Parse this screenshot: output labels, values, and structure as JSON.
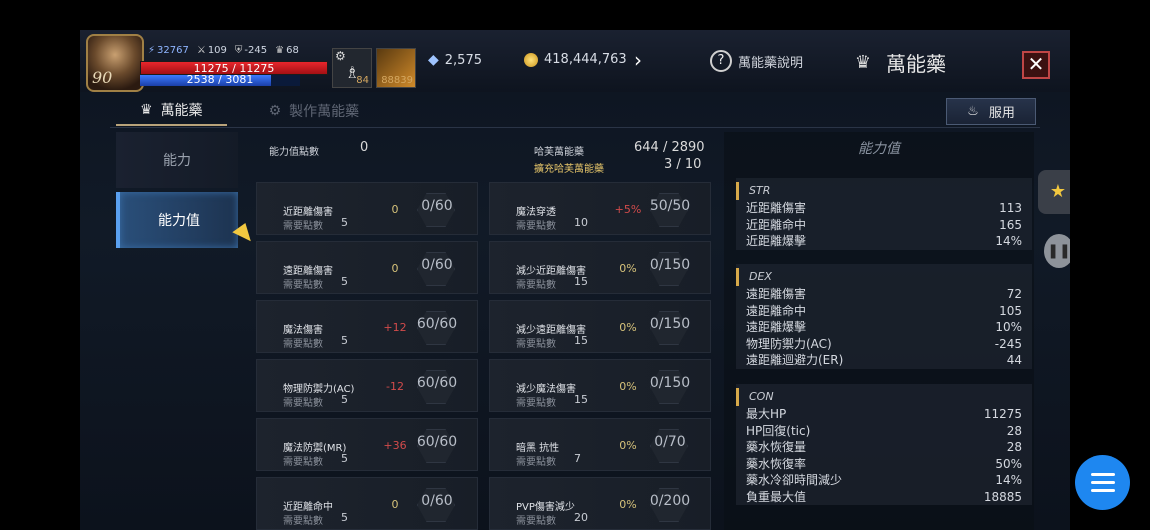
{
  "player": {
    "level": "90",
    "combat_power": "32767",
    "stat_a": "109",
    "stat_b": "-245",
    "stat_c": "68",
    "hp_text": "11275 / 11275",
    "mp_text": "2538 / 3081",
    "hp_ratio": 1.0,
    "mp_ratio": 0.82
  },
  "buffs": [
    {
      "icon": "potion-bottle-icon",
      "count": "84"
    },
    {
      "icon": "wing-item-icon",
      "count": "88839"
    }
  ],
  "currency": {
    "gem_amount": "2,575",
    "gold_amount": "418,444,763"
  },
  "header": {
    "help_label": "萬能藥說明",
    "title": "萬能藥",
    "close_label": "✕"
  },
  "tabs": [
    {
      "label": "萬能藥",
      "active": true
    },
    {
      "label": "製作萬能藥",
      "active": false
    }
  ],
  "use_button": {
    "label": "服用"
  },
  "left_nav": [
    {
      "label": "能力",
      "active": false
    },
    {
      "label": "能力值",
      "active": true
    }
  ],
  "info": {
    "points_label": "能力值點數",
    "points_value": "0",
    "elixir_label": "哈芙萬能藥",
    "elixir_value": "644 / 2890",
    "expand_label": "擴充哈芙萬能藥",
    "expand_value": "3 / 10"
  },
  "req_label": "需要點數",
  "cards_left": [
    {
      "name": "近距離傷害",
      "req": "5",
      "delta": "0",
      "value": "0/60",
      "delta_class": "zero"
    },
    {
      "name": "遠距離傷害",
      "req": "5",
      "delta": "0",
      "value": "0/60",
      "delta_class": "zero"
    },
    {
      "name": "魔法傷害",
      "req": "5",
      "delta": "+12",
      "value": "60/60",
      "delta_class": "pos"
    },
    {
      "name": "物理防禦力(AC)",
      "req": "5",
      "delta": "-12",
      "value": "60/60",
      "delta_class": "neg"
    },
    {
      "name": "魔法防禦(MR)",
      "req": "5",
      "delta": "+36",
      "value": "60/60",
      "delta_class": "pos"
    },
    {
      "name": "近距離命中",
      "req": "5",
      "delta": "0",
      "value": "0/60",
      "delta_class": "zero"
    }
  ],
  "cards_right": [
    {
      "name": "魔法穿透",
      "req": "10",
      "delta": "+5%",
      "value": "50/50",
      "delta_class": "pos"
    },
    {
      "name": "減少近距離傷害",
      "req": "15",
      "delta": "0%",
      "value": "0/150",
      "delta_class": "zero"
    },
    {
      "name": "減少遠距離傷害",
      "req": "15",
      "delta": "0%",
      "value": "0/150",
      "delta_class": "zero"
    },
    {
      "name": "減少魔法傷害",
      "req": "15",
      "delta": "0%",
      "value": "0/150",
      "delta_class": "zero"
    },
    {
      "name": "暗黑 抗性",
      "req": "7",
      "delta": "0%",
      "value": "0/70",
      "delta_class": "zero"
    },
    {
      "name": "PVP傷害減少",
      "req": "20",
      "delta": "0%",
      "value": "0/200",
      "delta_class": "zero"
    }
  ],
  "right_panel": {
    "title": "能力值",
    "sections": [
      {
        "head": "STR",
        "rows": [
          {
            "k": "近距離傷害",
            "v": "113"
          },
          {
            "k": "近距離命中",
            "v": "165"
          },
          {
            "k": "近距離爆擊",
            "v": "14%"
          }
        ]
      },
      {
        "head": "DEX",
        "rows": [
          {
            "k": "遠距離傷害",
            "v": "72"
          },
          {
            "k": "遠距離命中",
            "v": "105"
          },
          {
            "k": "遠距離爆擊",
            "v": "10%"
          },
          {
            "k": "物理防禦力(AC)",
            "v": "-245"
          },
          {
            "k": "遠距離迴避力(ER)",
            "v": "44"
          }
        ]
      },
      {
        "head": "CON",
        "rows": [
          {
            "k": "最大HP",
            "v": "11275"
          },
          {
            "k": "HP回復(tic)",
            "v": "28"
          },
          {
            "k": "藥水恢復量",
            "v": "28"
          },
          {
            "k": "藥水恢復率",
            "v": "50%"
          },
          {
            "k": "藥水冷卻時間減少",
            "v": "14%"
          },
          {
            "k": "負重最大值",
            "v": "18885"
          }
        ]
      }
    ]
  }
}
